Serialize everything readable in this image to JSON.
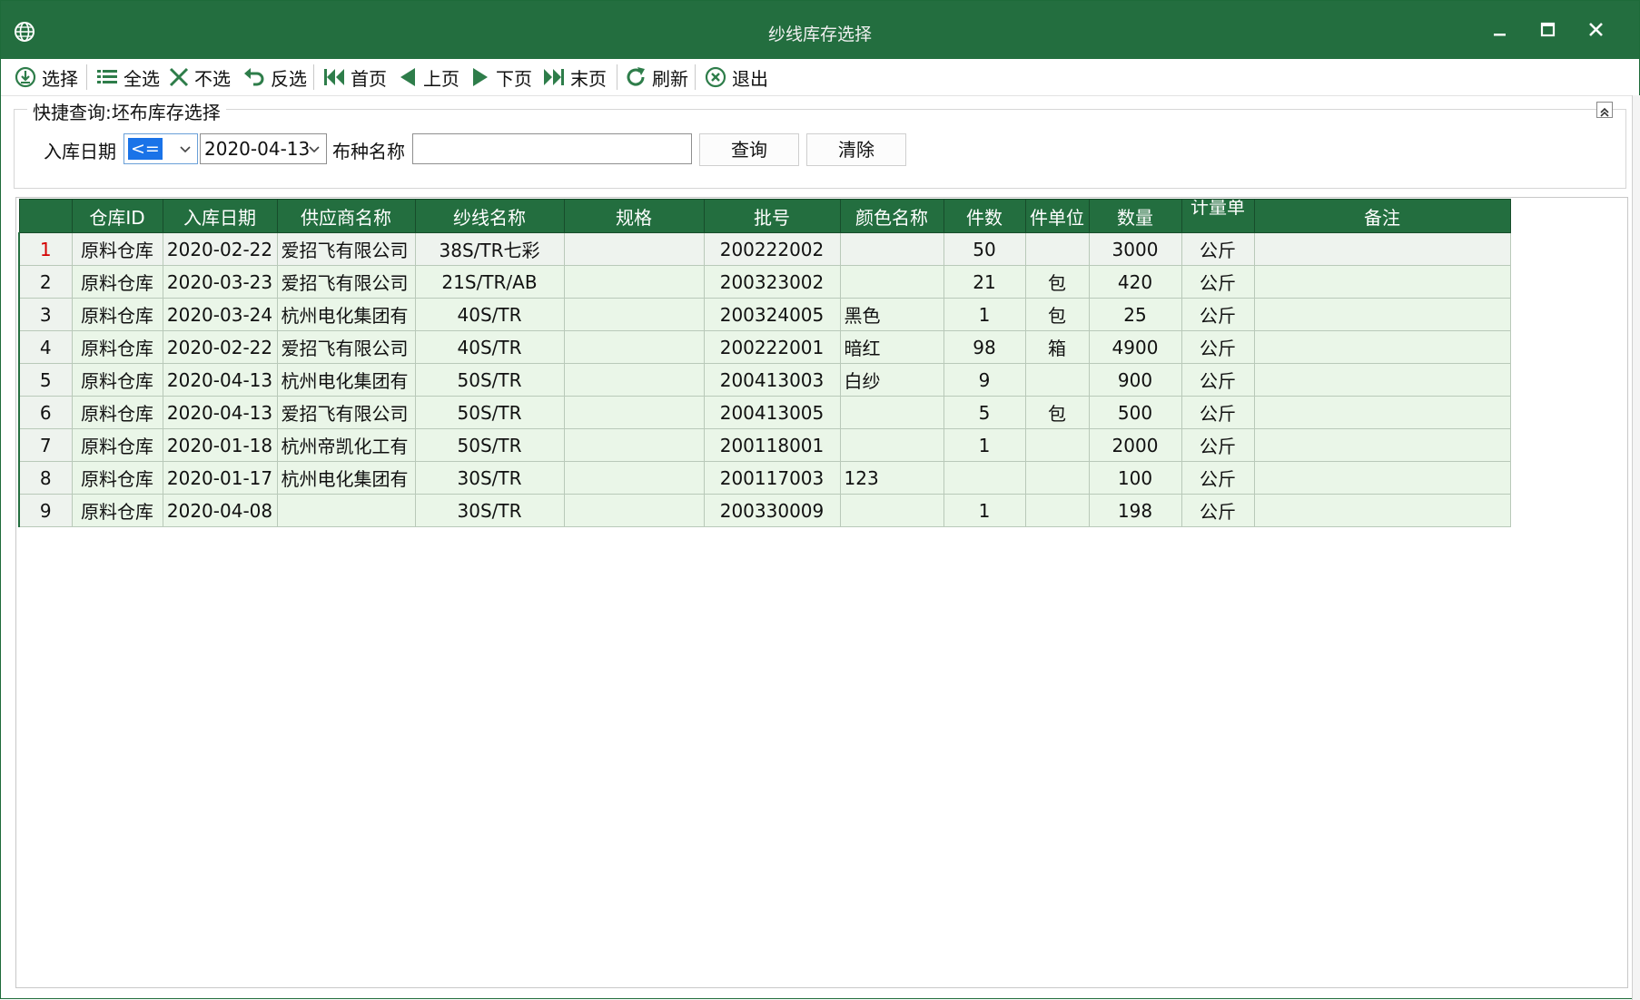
{
  "window": {
    "title": "纱线库存选择",
    "app_icon": "globe-icon",
    "controls": [
      "minimize-icon",
      "maximize-icon",
      "close-icon"
    ]
  },
  "toolbar": {
    "items": [
      {
        "label": "选择",
        "icon": "import-icon"
      },
      {
        "label": "全选",
        "icon": "list-icon"
      },
      {
        "label": "不选",
        "icon": "x-icon"
      },
      {
        "label": "反选",
        "icon": "undo-icon"
      },
      {
        "label": "首页",
        "icon": "first-page-icon"
      },
      {
        "label": "上页",
        "icon": "prev-page-icon"
      },
      {
        "label": "下页",
        "icon": "next-page-icon"
      },
      {
        "label": "末页",
        "icon": "last-page-icon"
      },
      {
        "label": "刷新",
        "icon": "refresh-icon"
      },
      {
        "label": "退出",
        "icon": "exit-icon"
      }
    ]
  },
  "query": {
    "legend": "快捷查询:坯布库存选择",
    "date_label": "入库日期",
    "operator": "<=",
    "date_value": "2020-04-13",
    "name_label": "布种名称",
    "name_value": "",
    "search_button": "查询",
    "clear_button": "清除"
  },
  "grid": {
    "columns": [
      "仓库ID",
      "入库日期",
      "供应商名称",
      "纱线名称",
      "规格",
      "批号",
      "颜色名称",
      "件数",
      "件单位",
      "数量",
      "计量单",
      "备注"
    ],
    "rows": [
      {
        "no": "1",
        "warehouse": "原料仓库",
        "date": "2020-02-22",
        "supplier": "爱招飞有限公司",
        "yarn": "38S/TR七彩",
        "spec": "",
        "batch": "200222002",
        "color": "",
        "pieces": "50",
        "piece_unit": "",
        "qty": "3000",
        "unit": "公斤",
        "remark": ""
      },
      {
        "no": "2",
        "warehouse": "原料仓库",
        "date": "2020-03-23",
        "supplier": "爱招飞有限公司",
        "yarn": "21S/TR/AB",
        "spec": "",
        "batch": "200323002",
        "color": "",
        "pieces": "21",
        "piece_unit": "包",
        "qty": "420",
        "unit": "公斤",
        "remark": ""
      },
      {
        "no": "3",
        "warehouse": "原料仓库",
        "date": "2020-03-24",
        "supplier": "杭州电化集团有",
        "yarn": "40S/TR",
        "spec": "",
        "batch": "200324005",
        "color": "黑色",
        "pieces": "1",
        "piece_unit": "包",
        "qty": "25",
        "unit": "公斤",
        "remark": ""
      },
      {
        "no": "4",
        "warehouse": "原料仓库",
        "date": "2020-02-22",
        "supplier": "爱招飞有限公司",
        "yarn": "40S/TR",
        "spec": "",
        "batch": "200222001",
        "color": "暗红",
        "pieces": "98",
        "piece_unit": "箱",
        "qty": "4900",
        "unit": "公斤",
        "remark": ""
      },
      {
        "no": "5",
        "warehouse": "原料仓库",
        "date": "2020-04-13",
        "supplier": "杭州电化集团有",
        "yarn": "50S/TR",
        "spec": "",
        "batch": "200413003",
        "color": "白纱",
        "pieces": "9",
        "piece_unit": "",
        "qty": "900",
        "unit": "公斤",
        "remark": ""
      },
      {
        "no": "6",
        "warehouse": "原料仓库",
        "date": "2020-04-13",
        "supplier": "爱招飞有限公司",
        "yarn": "50S/TR",
        "spec": "",
        "batch": "200413005",
        "color": "",
        "pieces": "5",
        "piece_unit": "包",
        "qty": "500",
        "unit": "公斤",
        "remark": ""
      },
      {
        "no": "7",
        "warehouse": "原料仓库",
        "date": "2020-01-18",
        "supplier": "杭州帝凯化工有",
        "yarn": "50S/TR",
        "spec": "",
        "batch": "200118001",
        "color": "",
        "pieces": "1",
        "piece_unit": "",
        "qty": "2000",
        "unit": "公斤",
        "remark": ""
      },
      {
        "no": "8",
        "warehouse": "原料仓库",
        "date": "2020-01-17",
        "supplier": "杭州电化集团有",
        "yarn": "30S/TR",
        "spec": "",
        "batch": "200117003",
        "color": "123",
        "pieces": "",
        "piece_unit": "",
        "qty": "100",
        "unit": "公斤",
        "remark": ""
      },
      {
        "no": "9",
        "warehouse": "原料仓库",
        "date": "2020-04-08",
        "supplier": "",
        "yarn": "30S/TR",
        "spec": "",
        "batch": "200330009",
        "color": "",
        "pieces": "1",
        "piece_unit": "",
        "qty": "198",
        "unit": "公斤",
        "remark": ""
      }
    ]
  },
  "colors": {
    "header_green": "#236e3f",
    "row_green": "#eaf6e8",
    "selected_row_number": "#d40000"
  }
}
